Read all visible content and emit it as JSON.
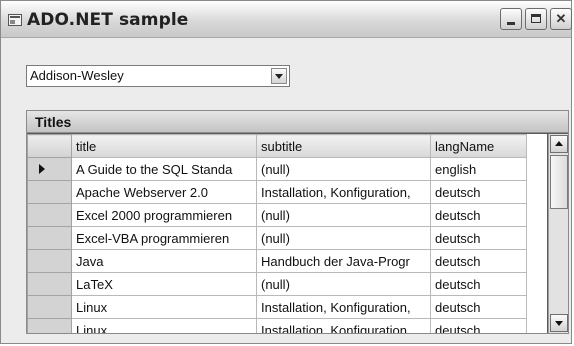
{
  "window": {
    "title": "ADO.NET sample"
  },
  "publisher": {
    "selected": "Addison-Wesley"
  },
  "grid": {
    "caption": "Titles",
    "columns": [
      "title",
      "subtitle",
      "langName"
    ],
    "rows": [
      [
        "A Guide to the SQL Standa",
        "(null)",
        "english"
      ],
      [
        "Apache Webserver 2.0",
        "Installation, Konfiguration,",
        "deutsch"
      ],
      [
        "Excel 2000 programmieren",
        "(null)",
        "deutsch"
      ],
      [
        "Excel-VBA programmieren",
        "(null)",
        "deutsch"
      ],
      [
        "Java",
        "Handbuch der Java-Progr",
        "deutsch"
      ],
      [
        "LaTeX",
        "(null)",
        "deutsch"
      ],
      [
        "Linux",
        "Installation, Konfiguration,",
        "deutsch"
      ],
      [
        "Linux",
        "Installation, Konfiguration,",
        "deutsch"
      ]
    ]
  }
}
